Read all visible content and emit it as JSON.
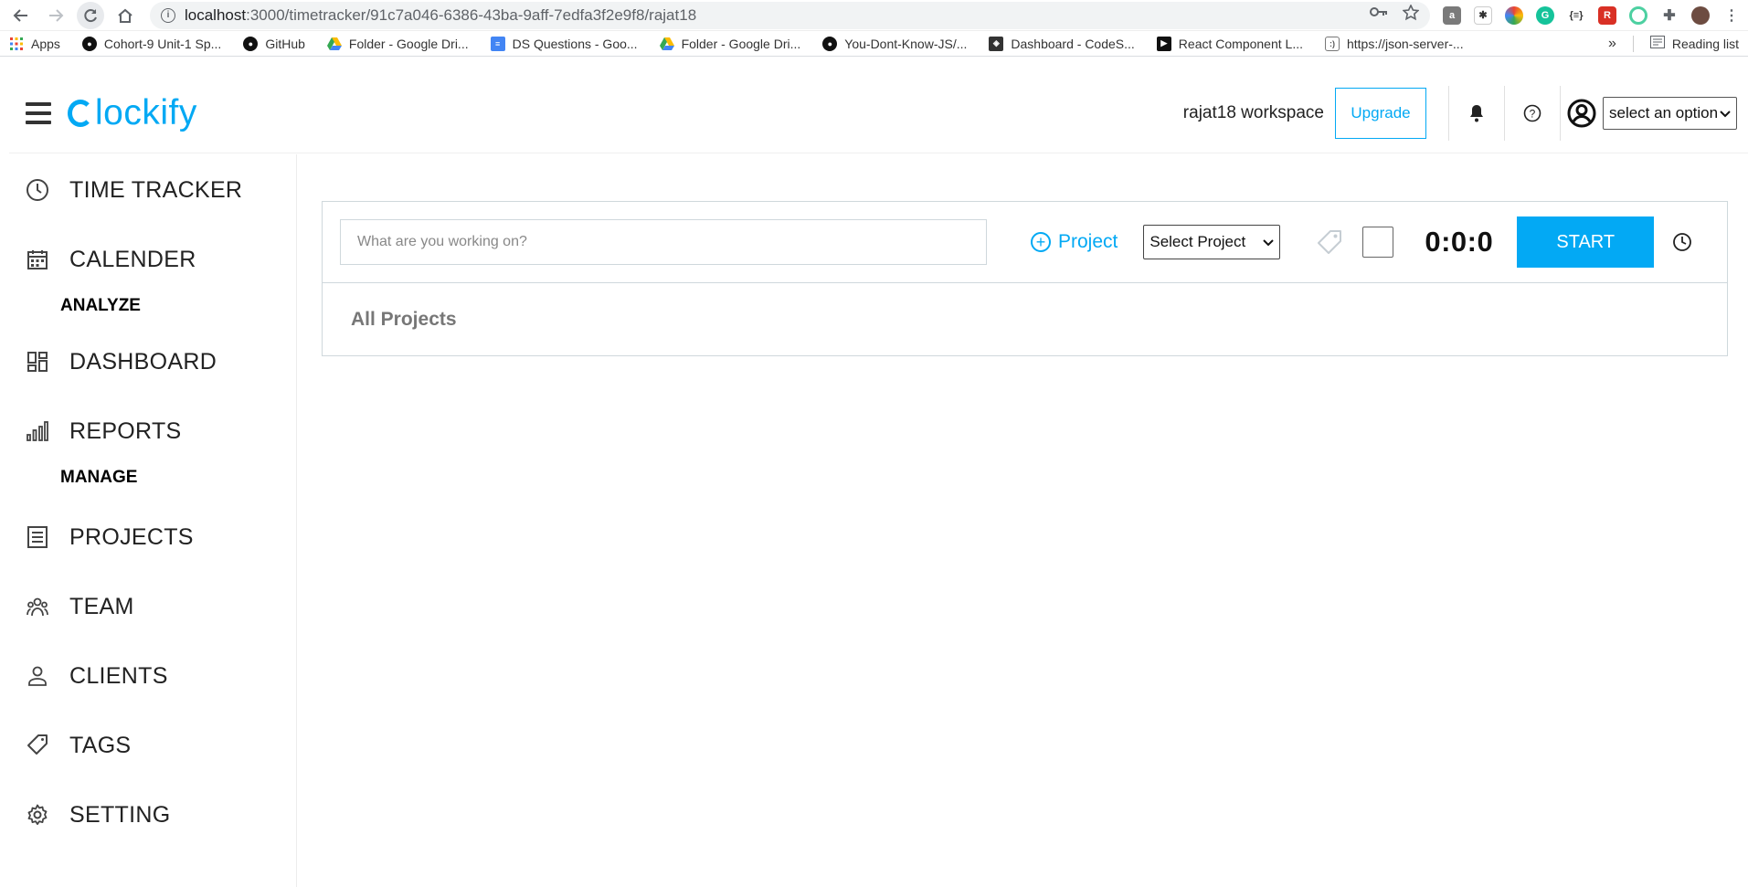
{
  "browser": {
    "url_host": "localhost",
    "url_rest": ":3000/timetracker/91c7a046-6386-43ba-9aff-7edfa3f2e9f8/rajat18",
    "bookmarks": [
      {
        "label": "Apps",
        "icon": "apps-grid-icon",
        "color": "#4285f4"
      },
      {
        "label": "Cohort-9 Unit-1 Sp...",
        "icon": "github-icon",
        "color": "#111111"
      },
      {
        "label": "GitHub",
        "icon": "github-icon",
        "color": "#111111"
      },
      {
        "label": "Folder - Google Dri...",
        "icon": "google-drive-icon",
        "color": "#f4b400"
      },
      {
        "label": "DS Questions - Goo...",
        "icon": "google-docs-icon",
        "color": "#4285f4"
      },
      {
        "label": "Folder - Google Dri...",
        "icon": "google-drive-icon",
        "color": "#f4b400"
      },
      {
        "label": "You-Dont-Know-JS/...",
        "icon": "github-icon",
        "color": "#111111"
      },
      {
        "label": "Dashboard - CodeS...",
        "icon": "codesandbox-icon",
        "color": "#333333"
      },
      {
        "label": "React Component L...",
        "icon": "react-component-icon",
        "color": "#111111"
      },
      {
        "label": "https://json-server-...",
        "icon": "json-server-icon",
        "color": "#555555"
      }
    ],
    "overflow_label": "»",
    "reading_list": "Reading list"
  },
  "header": {
    "logo_text": "lockify",
    "workspace": "rajat18 workspace",
    "upgrade_label": "Upgrade",
    "user_select_value": "select an option"
  },
  "sidebar": {
    "items": [
      {
        "label": "TIME TRACKER",
        "icon": "clock-icon"
      },
      {
        "label": "CALENDER",
        "icon": "calendar-icon"
      },
      {
        "heading": "ANALYZE"
      },
      {
        "label": "DASHBOARD",
        "icon": "dashboard-icon"
      },
      {
        "label": "REPORTS",
        "icon": "reports-icon"
      },
      {
        "heading": "MANAGE"
      },
      {
        "label": "PROJECTS",
        "icon": "projects-icon"
      },
      {
        "label": "TEAM",
        "icon": "team-icon"
      },
      {
        "label": "CLIENTS",
        "icon": "clients-icon"
      },
      {
        "label": "TAGS",
        "icon": "tag-icon"
      },
      {
        "label": "SETTING",
        "icon": "gear-icon"
      }
    ]
  },
  "tracker": {
    "description_placeholder": "What are you working on?",
    "project_link": "Project",
    "project_select_value": "Select Project",
    "timer": "0:0:0",
    "start_label": "START",
    "all_projects": "All Projects"
  },
  "colors": {
    "accent": "#03a9f4"
  }
}
